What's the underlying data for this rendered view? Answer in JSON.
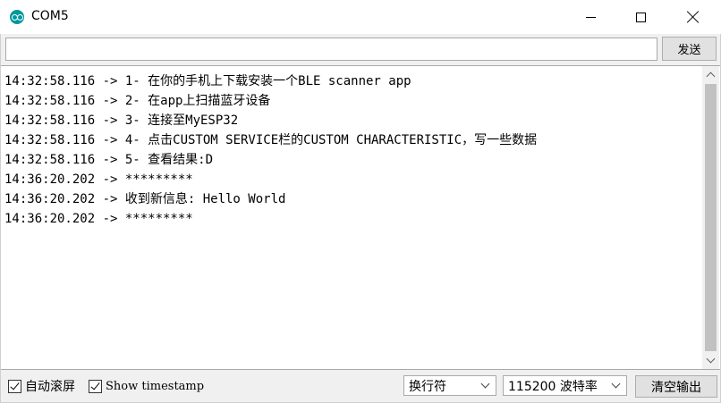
{
  "window": {
    "title": "COM5",
    "app_icon": "arduino-icon",
    "controls": [
      "minimize-icon",
      "maximize-icon",
      "close-icon"
    ]
  },
  "input": {
    "value": "",
    "send_label": "发送"
  },
  "output": {
    "lines": [
      "14:32:58.116 -> 1- 在你的手机上下载安装一个BLE scanner app",
      "14:32:58.116 -> 2- 在app上扫描蓝牙设备",
      "14:32:58.116 -> 3- 连接至MyESP32",
      "14:32:58.116 -> 4- 点击CUSTOM SERVICE栏的CUSTOM CHARACTERISTIC，写一些数据",
      "14:32:58.116 -> 5- 查看结果:D",
      "14:36:20.202 -> *********",
      "14:36:20.202 -> 收到新信息: Hello World",
      "14:36:20.202 -> *********"
    ]
  },
  "footer": {
    "autoscroll_label": "自动滚屏",
    "autoscroll_checked": true,
    "timestamp_label": "Show timestamp",
    "timestamp_checked": true,
    "line_ending": "换行符",
    "baud_rate": "115200 波特率",
    "clear_label": "清空输出"
  }
}
